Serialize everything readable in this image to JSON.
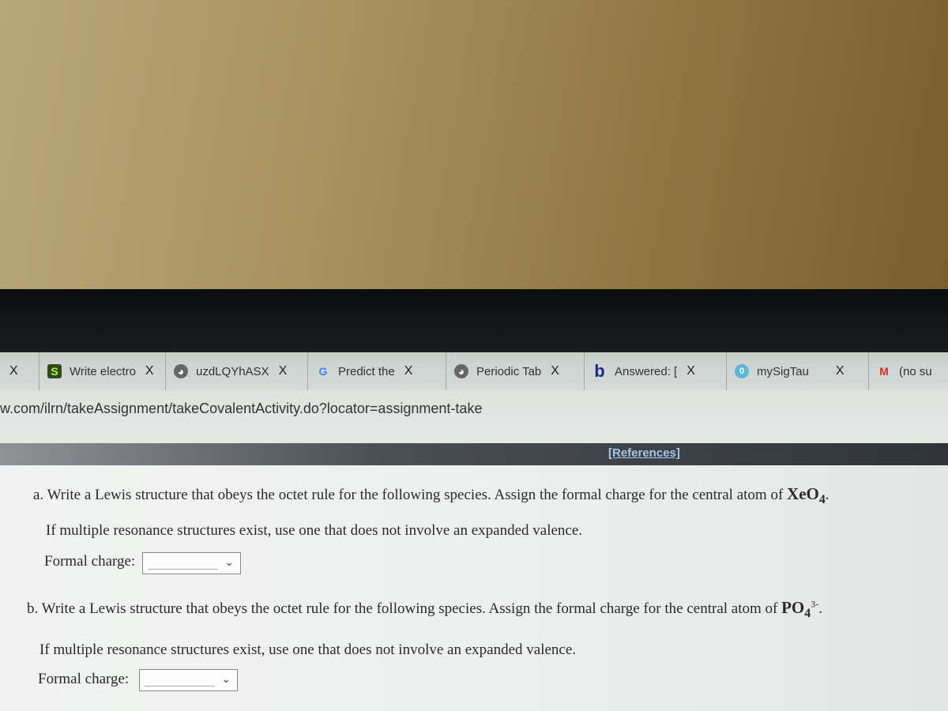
{
  "browser": {
    "tabs": [
      {
        "label": "Write electro",
        "icon": "s-icon"
      },
      {
        "label": "uzdLQYhASX",
        "icon": "globe-icon"
      },
      {
        "label": "Predict the",
        "icon": "google-icon"
      },
      {
        "label": "Periodic Tab",
        "icon": "globe-icon"
      },
      {
        "label": "Answered: [",
        "icon": "bartleby-b-icon"
      },
      {
        "label": "mySigTau",
        "icon": "circle-icon"
      },
      {
        "label": "(no su",
        "icon": "gmail-icon"
      }
    ],
    "close_label": "X",
    "url": "w.com/ilrn/takeAssignment/takeCovalentActivity.do?locator=assignment-take"
  },
  "page": {
    "references": "[References]",
    "qa": {
      "text": "a. Write a Lewis structure that obeys the octet rule for the following species. Assign the formal charge for the central atom of ",
      "species": "XeO",
      "sub": "4",
      "end": ".",
      "note": "If multiple resonance structures exist, use one that does not involve an expanded valence.",
      "label": "Formal charge:"
    },
    "qb": {
      "text": "b. Write a Lewis structure that obeys the octet rule for the following species. Assign the formal charge for the central atom of ",
      "species": "PO",
      "sub": "4",
      "sup": "3-",
      "end": ".",
      "note": "If multiple resonance structures exist, use one that does not involve an expanded valence.",
      "label": "Formal charge:"
    }
  }
}
